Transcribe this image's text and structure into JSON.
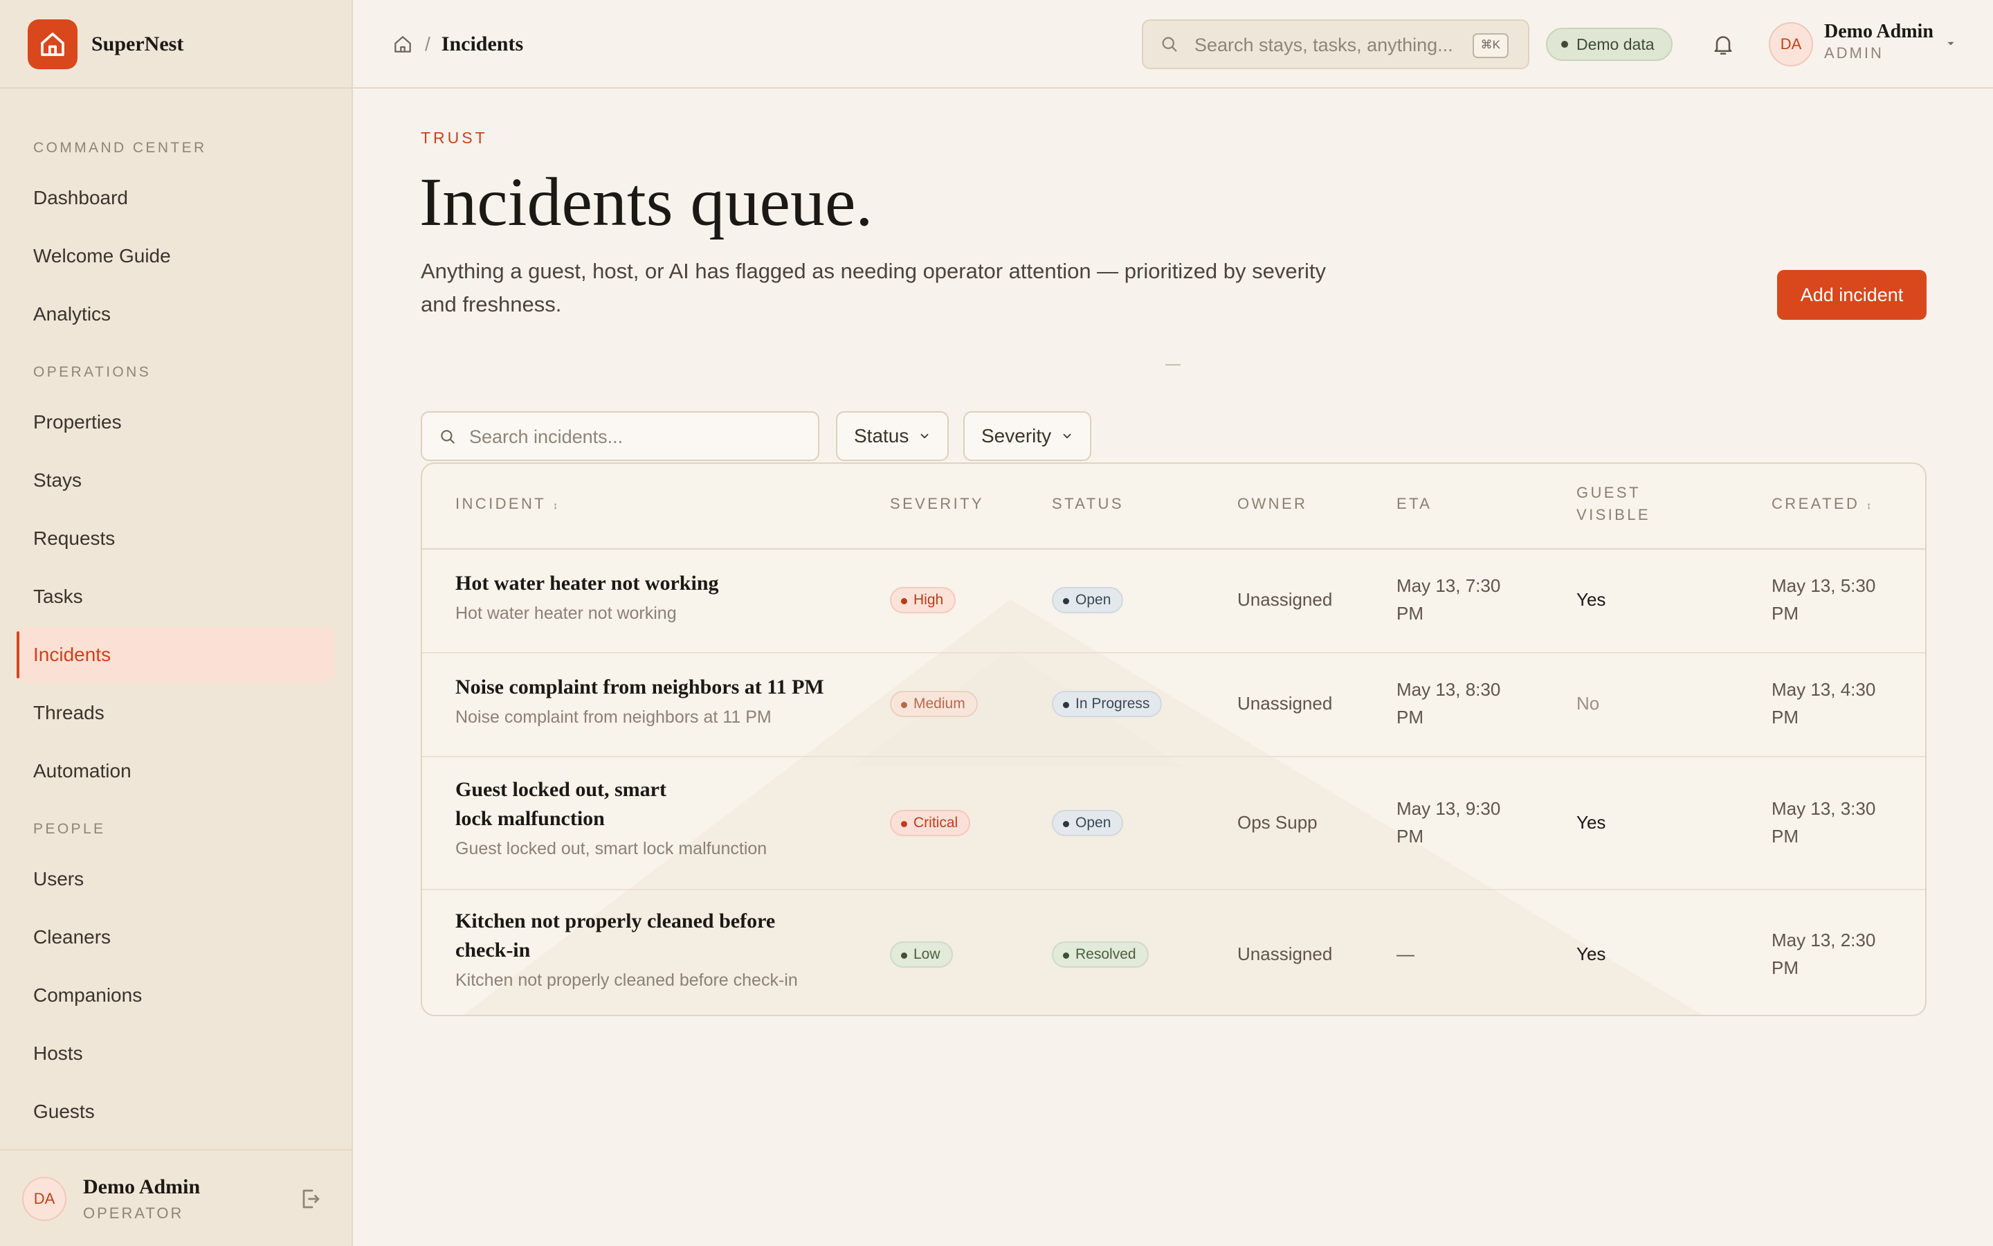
{
  "brand": {
    "name": "SuperNest"
  },
  "sidebar": {
    "sections": [
      {
        "title": "COMMAND CENTER",
        "items": [
          {
            "label": "Dashboard"
          },
          {
            "label": "Welcome Guide"
          },
          {
            "label": "Analytics"
          }
        ]
      },
      {
        "title": "OPERATIONS",
        "items": [
          {
            "label": "Properties"
          },
          {
            "label": "Stays"
          },
          {
            "label": "Requests"
          },
          {
            "label": "Tasks"
          },
          {
            "label": "Incidents",
            "active": true
          },
          {
            "label": "Threads"
          },
          {
            "label": "Automation"
          }
        ]
      },
      {
        "title": "PEOPLE",
        "items": [
          {
            "label": "Users"
          },
          {
            "label": "Cleaners"
          },
          {
            "label": "Companions"
          },
          {
            "label": "Hosts"
          },
          {
            "label": "Guests"
          }
        ]
      }
    ],
    "user": {
      "initials": "DA",
      "name": "Demo Admin",
      "role": "OPERATOR"
    }
  },
  "topbar": {
    "breadcrumb_current": "Incidents",
    "breadcrumb_sep": "/",
    "search_placeholder": "Search stays, tasks, anything...",
    "search_shortcut": "⌘K",
    "demo_label": "Demo data",
    "user": {
      "initials": "DA",
      "name": "Demo Admin",
      "role": "ADMIN"
    }
  },
  "page": {
    "eyebrow": "TRUST",
    "title": "Incidents queue.",
    "subtitle": "Anything a guest, host, or AI has flagged as needing operator attention — prioritized by severity and freshness.",
    "add_button": "Add incident",
    "loading_mark": "—"
  },
  "filters": {
    "search_placeholder": "Search incidents...",
    "status_label": "Status",
    "severity_label": "Severity"
  },
  "table": {
    "headers": {
      "incident": "INCIDENT",
      "severity": "SEVERITY",
      "status": "STATUS",
      "owner": "OWNER",
      "eta": "ETA",
      "guest_visible_1": "GUEST",
      "guest_visible_2": "VISIBLE",
      "created": "CREATED"
    },
    "rows": [
      {
        "title_l1": "Hot water heater not working",
        "title_l2": "",
        "subtitle": "Hot water heater not working",
        "severity": "High",
        "status": "Open",
        "owner": "Unassigned",
        "eta_l1": "May 13, 7:30",
        "eta_l2": "PM",
        "guest_visible": "Yes",
        "created_l1": "May 13, 5:30",
        "created_l2": "PM"
      },
      {
        "title_l1": "Noise complaint from neighbors at 11 PM",
        "title_l2": "",
        "subtitle": "Noise complaint from neighbors at 11 PM",
        "severity": "Medium",
        "status": "In Progress",
        "owner": "Unassigned",
        "eta_l1": "May 13, 8:30",
        "eta_l2": "PM",
        "guest_visible": "No",
        "created_l1": "May 13, 4:30",
        "created_l2": "PM"
      },
      {
        "title_l1": "Guest locked out, smart",
        "title_l2": "lock malfunction",
        "subtitle": "Guest locked out, smart lock malfunction",
        "severity": "Critical",
        "status": "Open",
        "owner": "Ops Supp",
        "eta_l1": "May 13, 9:30",
        "eta_l2": "PM",
        "guest_visible": "Yes",
        "created_l1": "May 13, 3:30",
        "created_l2": "PM"
      },
      {
        "title_l1": "Kitchen not properly cleaned before",
        "title_l2": "check-in",
        "subtitle": "Kitchen not properly cleaned before check-in",
        "severity": "Low",
        "status": "Resolved",
        "owner": "Unassigned",
        "eta_l1": "—",
        "eta_l2": "",
        "guest_visible": "Yes",
        "created_l1": "May 13, 2:30",
        "created_l2": "PM"
      }
    ]
  },
  "icons": {
    "brand": "house-icon",
    "breadcrumb_home": "home-icon",
    "search": "search-icon",
    "bell": "bell-icon",
    "caret": "chevron-down-icon",
    "logout": "logout-icon"
  },
  "colors": {
    "accent": "#d9471c",
    "background": "#f7f3ec",
    "sidebar": "#f0e6d7"
  }
}
